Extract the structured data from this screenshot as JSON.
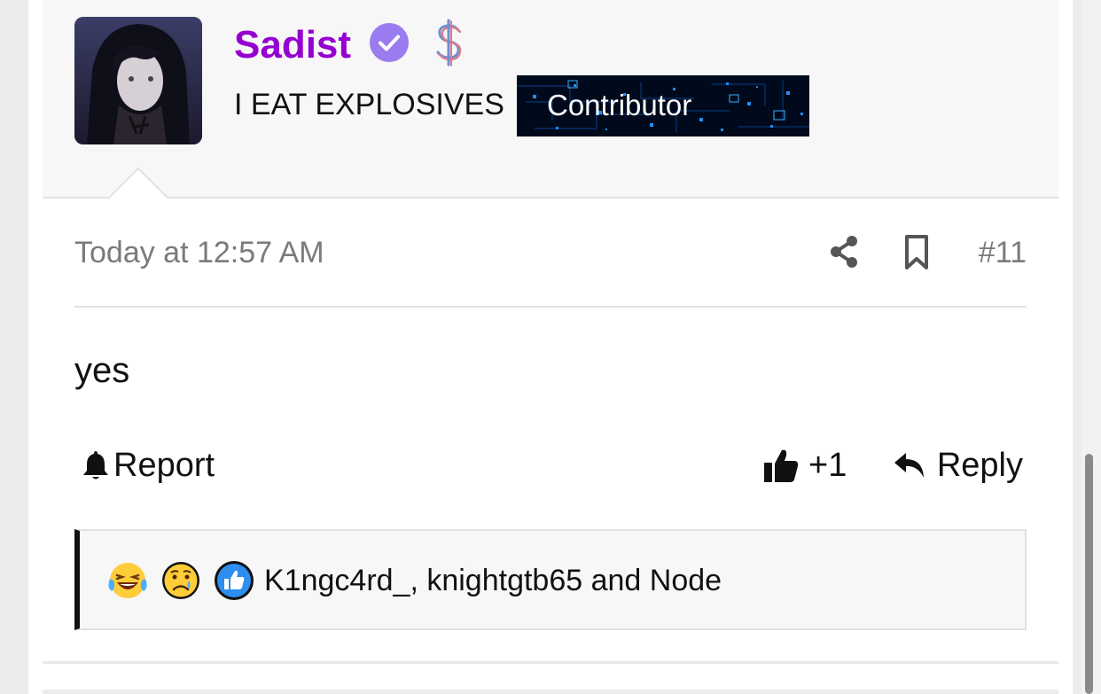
{
  "author": {
    "username": "Sadist",
    "username_color": "#9500d1",
    "verified_icon": "verified-check-icon",
    "verified_color": "#9a7cf0",
    "donor_icon": "dollar-sign-icon",
    "user_title": "I EAT EXPLOSIVES",
    "badge": {
      "label": "Contributor",
      "background": "#010a1c"
    }
  },
  "post": {
    "timestamp": "Today at 12:57 AM",
    "post_number": "#11",
    "message": "yes"
  },
  "actions": {
    "report_label": "Report",
    "like_label": "+1",
    "reply_label": "Reply"
  },
  "reactions": {
    "emojis": [
      "laughing-crying-emoji",
      "sad-crying-emoji",
      "thumbs-up-reaction"
    ],
    "users_text": "K1ngc4rd_, knightgtb65 and Node"
  }
}
